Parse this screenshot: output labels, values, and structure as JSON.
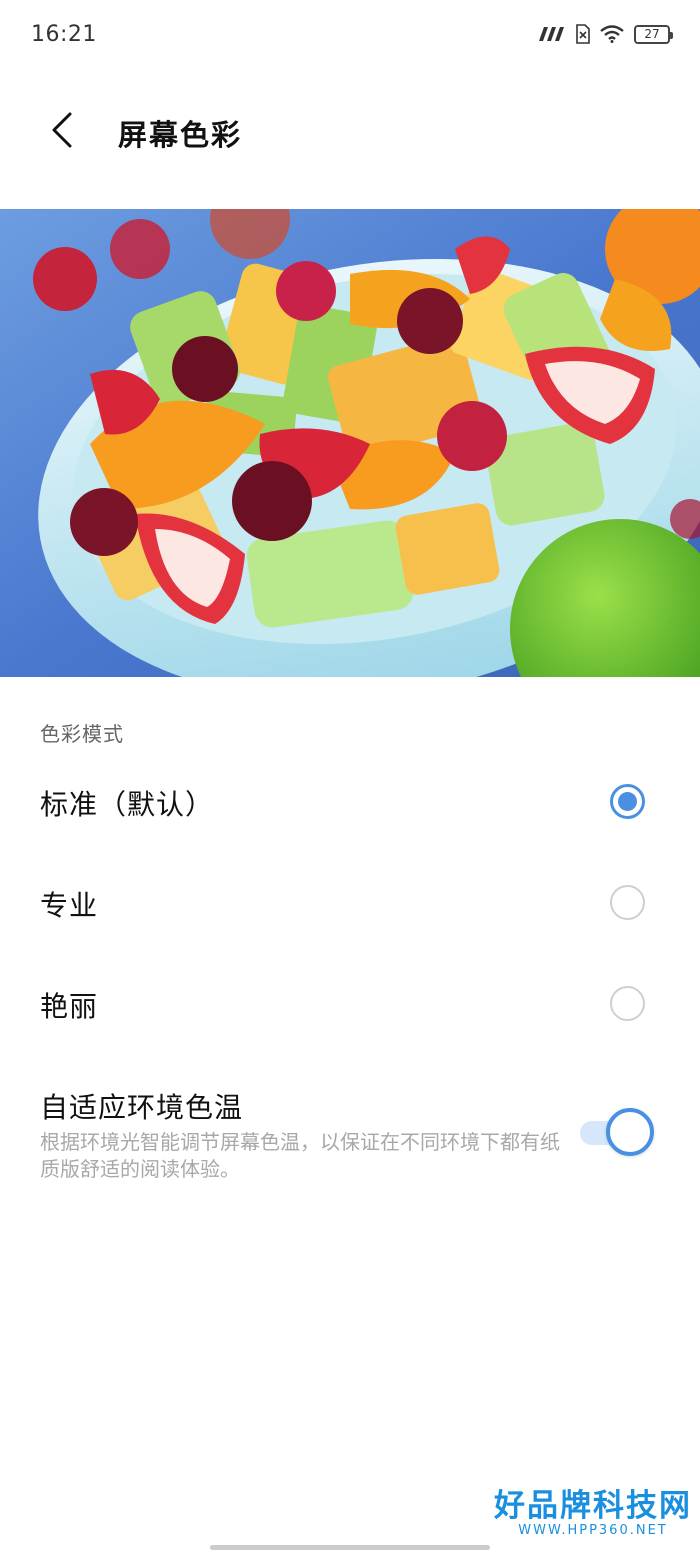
{
  "status_bar": {
    "time": "16:21",
    "battery": "27"
  },
  "header": {
    "title": "屏幕色彩"
  },
  "color_mode": {
    "section_label": "色彩模式",
    "options": [
      {
        "label": "标准（默认）",
        "selected": true
      },
      {
        "label": "专业",
        "selected": false
      },
      {
        "label": "艳丽",
        "selected": false
      }
    ]
  },
  "adaptive": {
    "title": "自适应环境色温",
    "description": "根据环境光智能调节屏幕色温，以保证在不同环境下都有纸质版舒适的阅读体验。",
    "enabled": true
  },
  "watermark": {
    "main": "好品牌科技网",
    "sub": "WWW.HPP360.NET"
  },
  "colors": {
    "accent": "#4a90e2",
    "toggle_track": "#d6e7fb"
  }
}
